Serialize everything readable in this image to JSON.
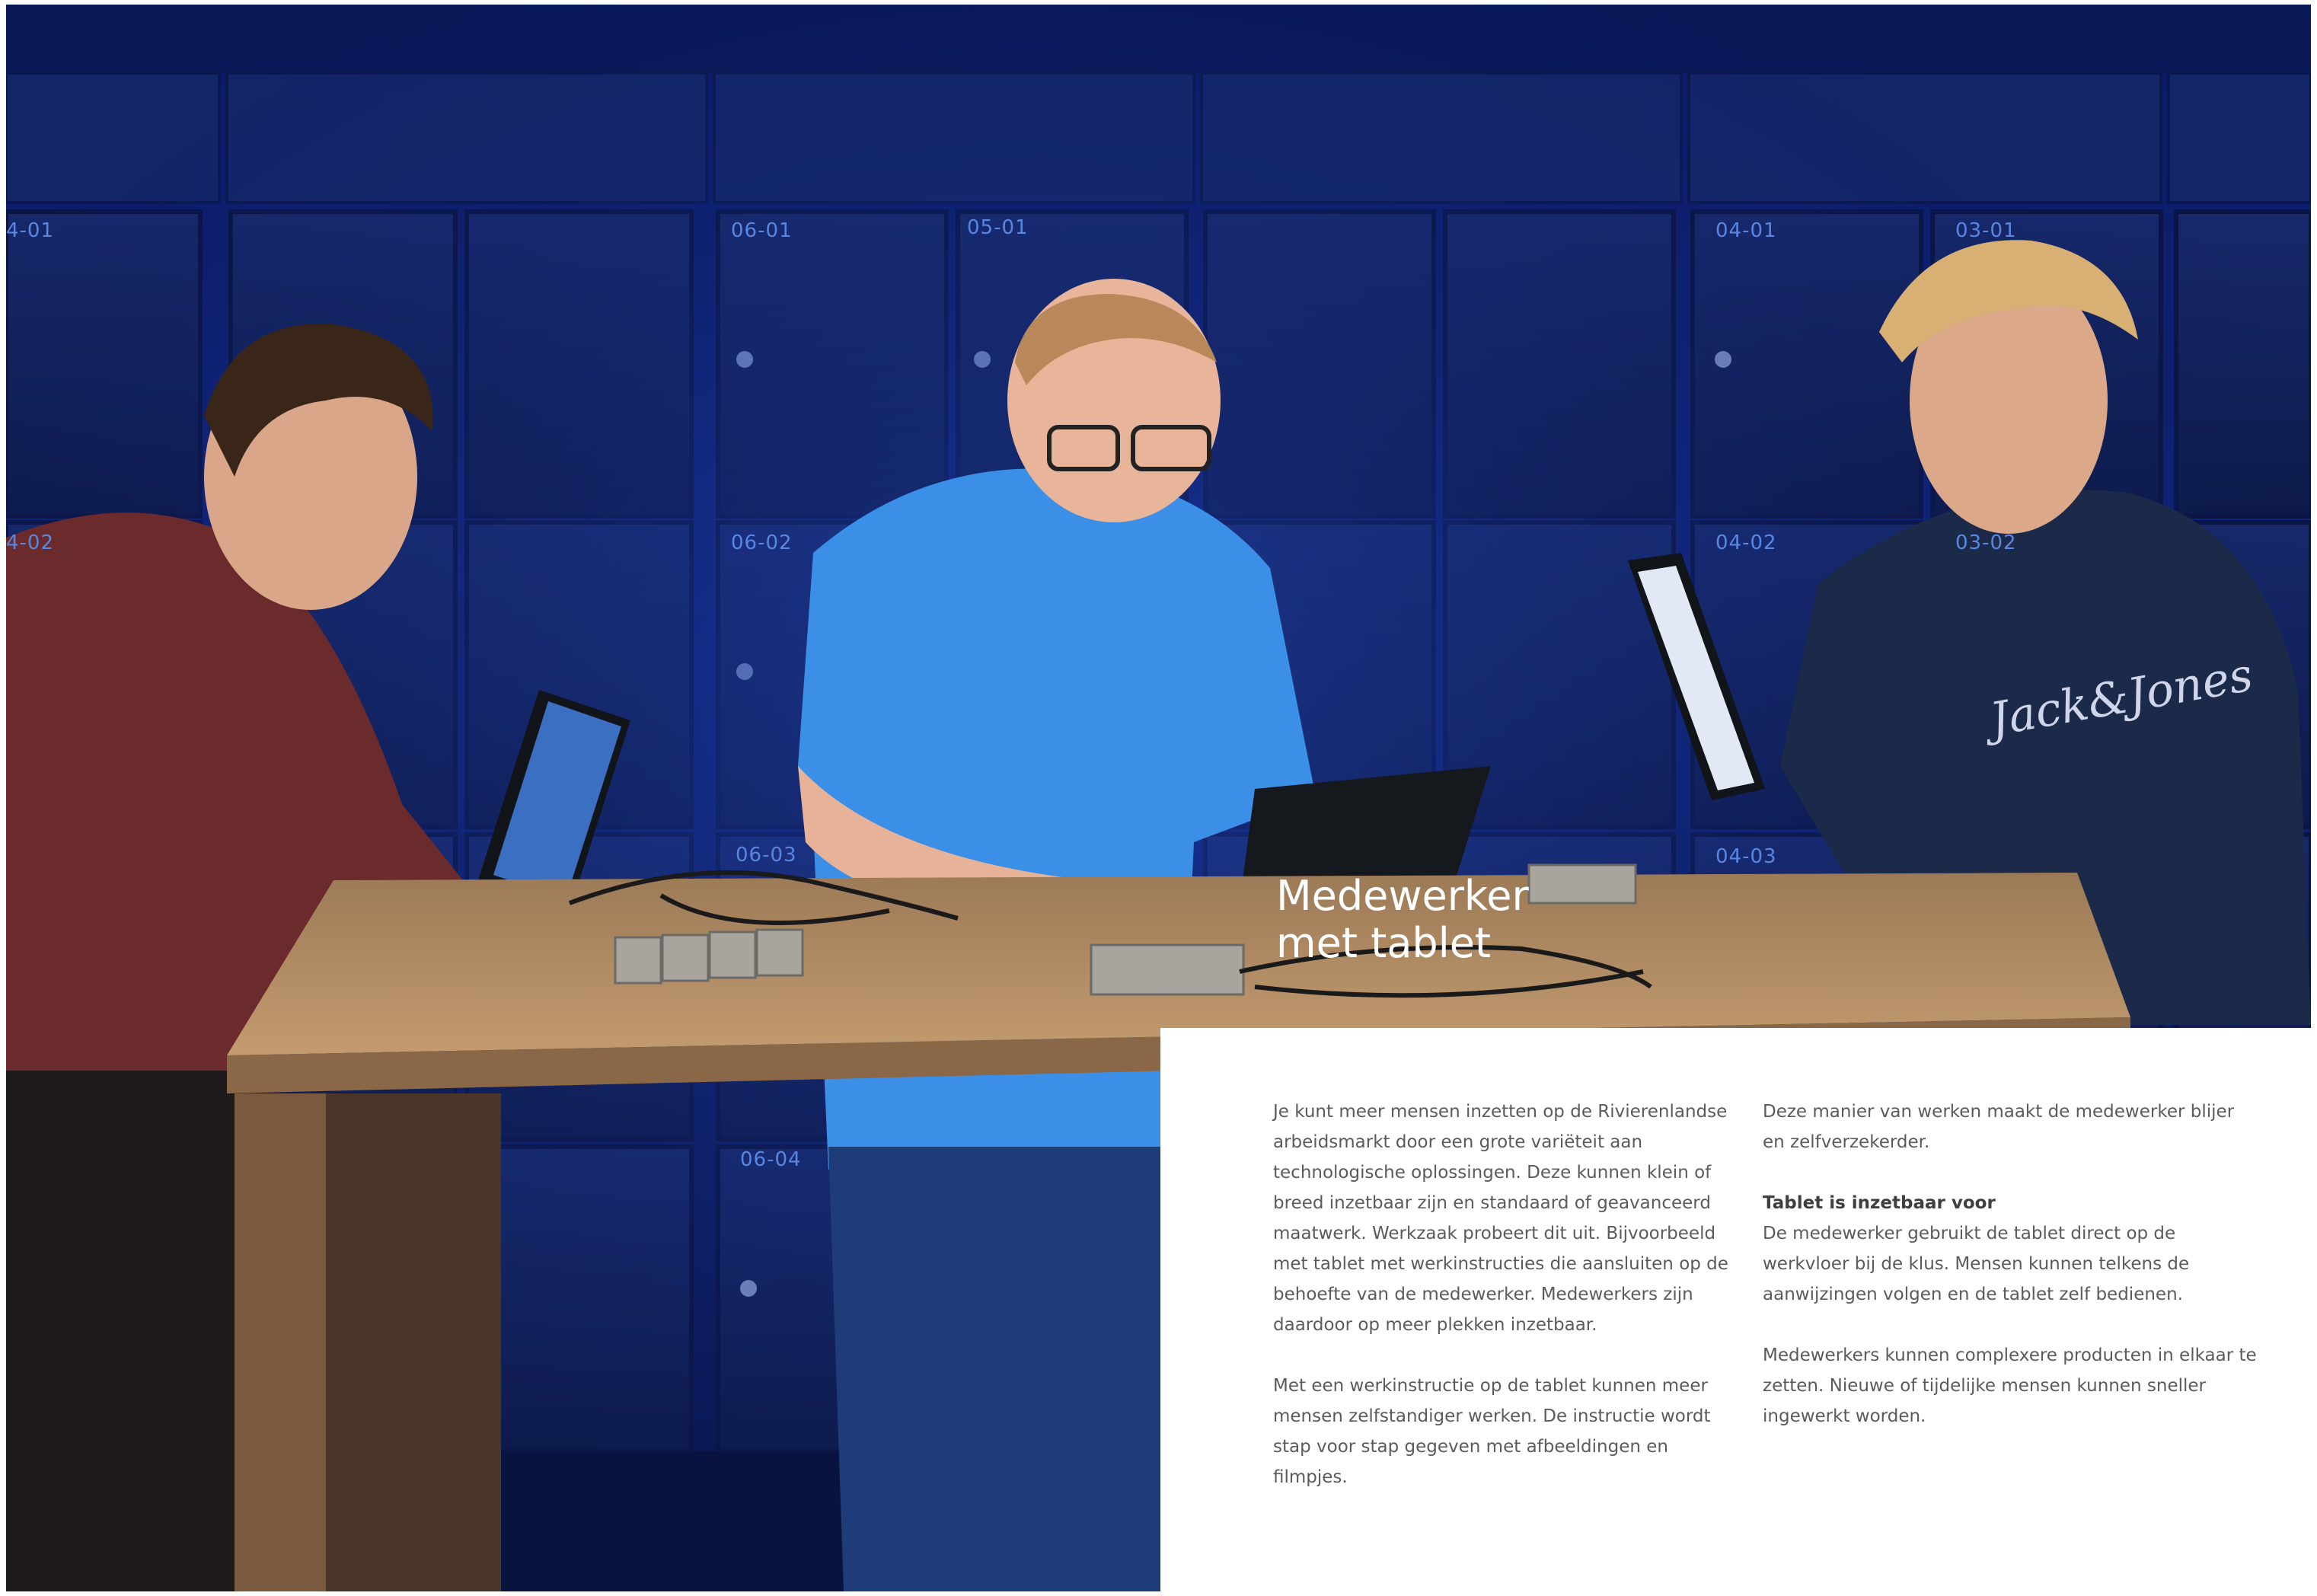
{
  "photo": {
    "locker_numbers": [
      "4-01",
      "06-01",
      "05-01",
      "04-01",
      "03-01",
      "4-02",
      "06-02",
      "04-02",
      "03-02",
      "06-03",
      "04-03",
      "06-04"
    ],
    "colors": {
      "background": "#0f2378",
      "locker": "#14275f",
      "table_top": "#b08a62",
      "table_side": "#7a5a3e"
    }
  },
  "headline": {
    "line1": "Medewerker",
    "line2": "met tablet"
  },
  "text": {
    "left": {
      "p1": "Je kunt meer mensen inzetten op de Rivierenlandse arbeidsmarkt door een grote variëteit aan technologische oplossingen. Deze kunnen klein of breed inzetbaar zijn en standaard of geavanceerd maatwerk. Werkzaak probeert dit uit. Bijvoorbeeld met tablet met werkinstructies die aansluiten op de behoefte van de medewerker. Medewerkers zijn daardoor op meer plekken inzetbaar.",
      "p2": "Met een werkinstructie op de tablet kunnen meer mensen zelfstandiger werken. De instructie wordt stap voor stap gegeven met afbeeldingen en filmpjes."
    },
    "right": {
      "p1": "Deze manier van werken maakt de medewerker blijer en zelfverzekerder.",
      "subheading": "Tablet is inzetbaar voor",
      "p2": "De medewerker gebruikt de tablet direct op de werkvloer bij de klus. Mensen kunnen telkens de aanwijzingen volgen en de tablet zelf bedienen.",
      "p3": "Medewerkers kunnen complexere producten in elkaar te zetten. Nieuwe of tijdelijke mensen kunnen sneller ingewerkt worden."
    }
  }
}
